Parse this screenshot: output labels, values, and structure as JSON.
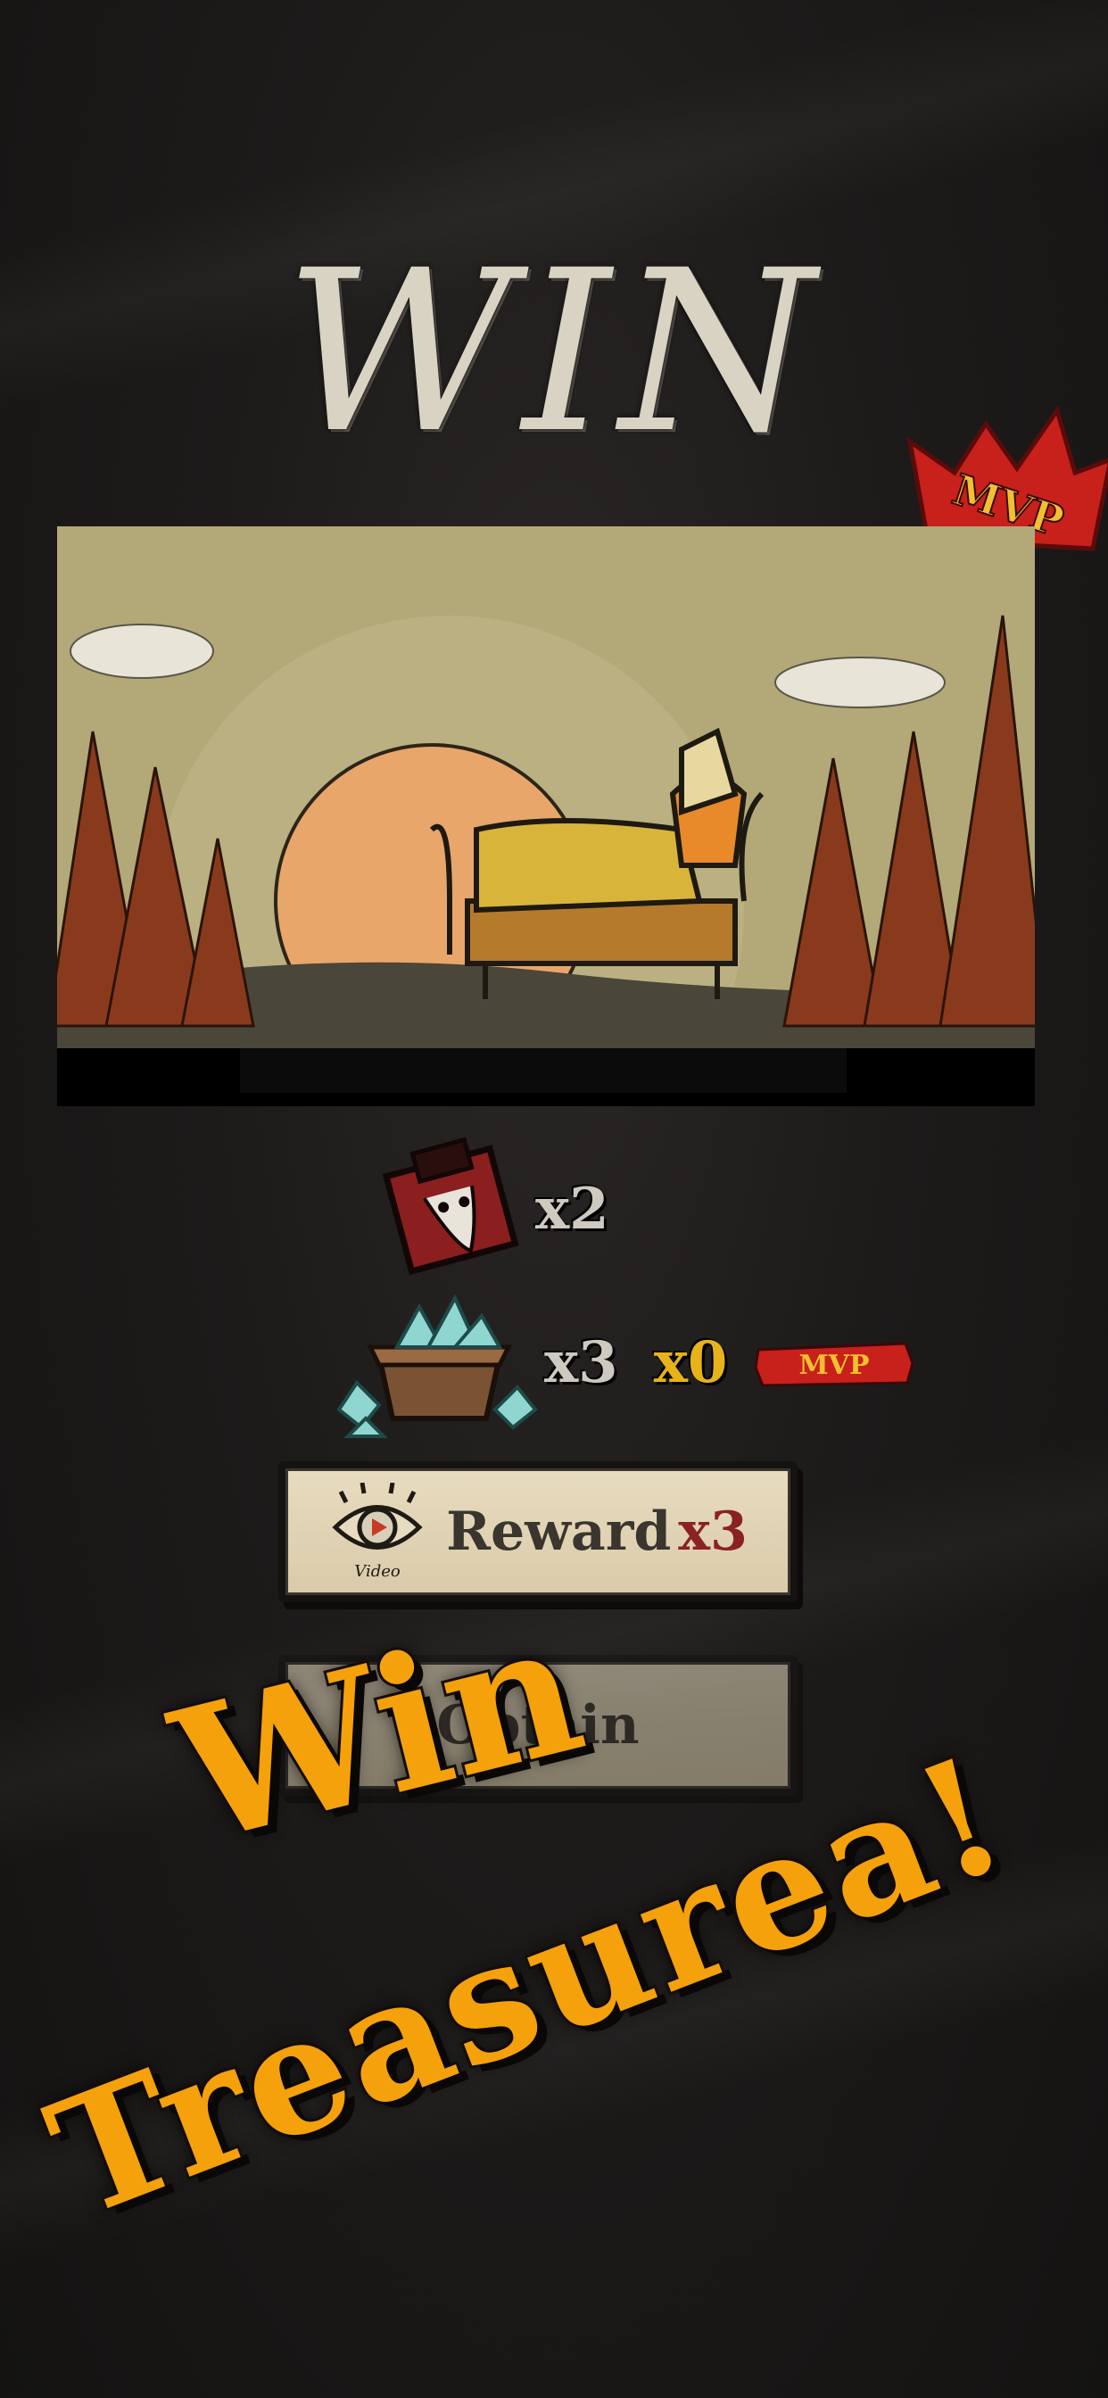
{
  "title": "WIN",
  "mvp_badge": "MVP",
  "rewards": [
    {
      "icon": "puzzle-fragment-icon",
      "quantity": "x2"
    },
    {
      "icon": "gem-crate-icon",
      "quantity": "x3",
      "mvp_bonus": "x0",
      "mvp_tag": "MVP"
    }
  ],
  "buttons": {
    "reward_label": "Reward",
    "reward_multiplier": "x3",
    "video_caption": "Video",
    "obtain_label": "Obtain"
  },
  "promo": {
    "line1": "Win",
    "line2": "Treasurea!"
  },
  "colors": {
    "promo_orange": "#f5a10c",
    "mvp_red": "#c8201b",
    "gold": "#e8b21a",
    "button_parchment": "#e3d6b8"
  }
}
